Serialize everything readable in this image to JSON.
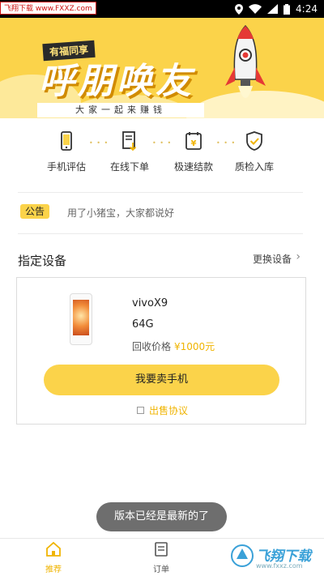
{
  "status_bar": {
    "watermark": "飞翔下载 www.FXXZ.com",
    "time": "4:24"
  },
  "banner": {
    "small_text": "有福同享",
    "big_text": "呼朋唤友",
    "sub_text": "大家一起来赚钱"
  },
  "features": [
    {
      "label": "手机评估",
      "icon": "phone-icon"
    },
    {
      "label": "在线下单",
      "icon": "order-icon"
    },
    {
      "label": "极速结款",
      "icon": "payment-icon"
    },
    {
      "label": "质检入库",
      "icon": "quality-check-icon"
    }
  ],
  "notice": {
    "badge": "公告",
    "text": "用了小猪宝，大家都说好"
  },
  "device_section": {
    "title": "指定设备",
    "change_label": "更换设备",
    "model": "vivoX9",
    "storage": "64G",
    "price_label": "回收价格",
    "price_value": "¥1000元",
    "sell_button": "我要卖手机",
    "agreement": "出售协议"
  },
  "toast": "版本已经是最新的了",
  "bottom_nav": {
    "home": "推荐",
    "order": "订单"
  },
  "watermark_bottom": {
    "text": "飞翔下载",
    "url": "www.fxxz.com"
  },
  "colors": {
    "accent": "#fbd34a",
    "price": "#f0b400"
  }
}
